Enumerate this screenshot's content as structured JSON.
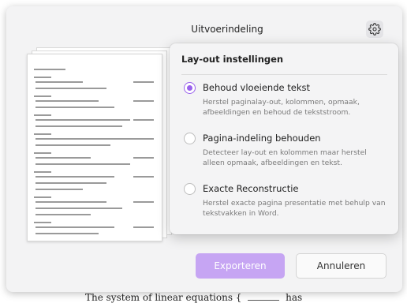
{
  "dialog": {
    "title": "Uitvoerindeling",
    "export_label": "Exporteren",
    "cancel_label": "Annuleren"
  },
  "layout_settings": {
    "title": "Lay-out instellingen",
    "options": [
      {
        "label": "Behoud vloeiende tekst",
        "description": "Herstel paginalay-out, kolommen, opmaak, afbeeldingen en behoud de tekststroom.",
        "selected": true
      },
      {
        "label": "Pagina-indeling behouden",
        "description": "Detecteer lay-out en kolommen maar herstel alleen opmaak, afbeeldingen en tekst.",
        "selected": false
      },
      {
        "label": "Exacte Reconstructie",
        "description": "Herstel exacte pagina presentatie met behulp van tekstvakken in Word.",
        "selected": false
      }
    ]
  },
  "background_document": {
    "visible_text": "The system of linear equations {",
    "visible_text_suffix": "has"
  },
  "colors": {
    "accent": "#9a62ec",
    "export_button": "#c6a5f3"
  },
  "icons": {
    "settings": "gear-icon"
  }
}
